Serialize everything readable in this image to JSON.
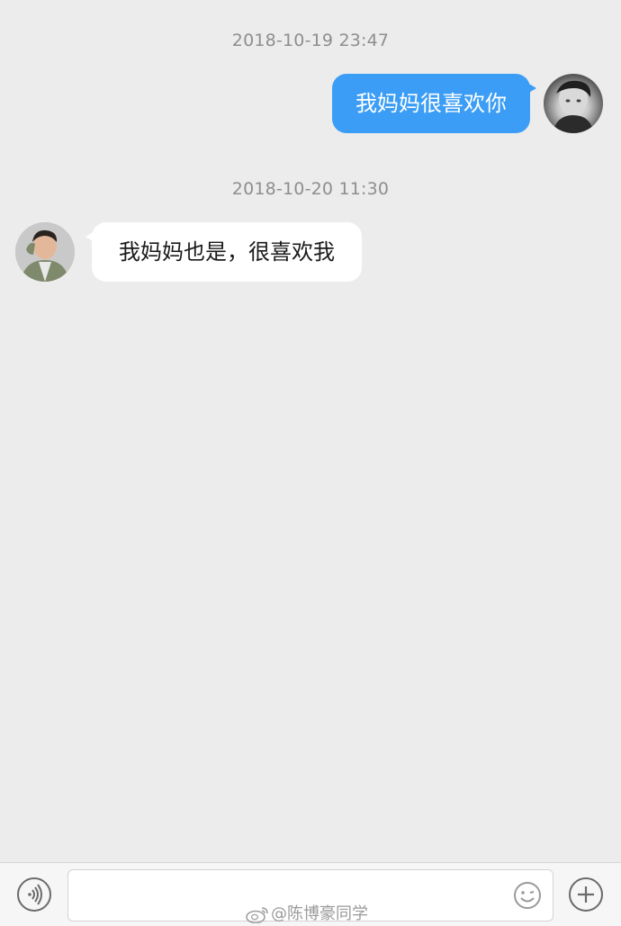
{
  "conversation": {
    "messages": [
      {
        "timestamp": "2018-10-19 23:47",
        "side": "right",
        "text": "我妈妈很喜欢你"
      },
      {
        "timestamp": "2018-10-20 11:30",
        "side": "left",
        "text": "我妈妈也是，很喜欢我"
      }
    ]
  },
  "colors": {
    "background": "#ececed",
    "outgoing_bubble": "#3b9df5",
    "incoming_bubble": "#ffffff",
    "timestamp_text": "#8e8e8e"
  },
  "input_bar": {
    "value": "",
    "placeholder": "",
    "left_icon": "voice-icon",
    "emoji_icon": "emoji-icon",
    "right_icon": "plus-icon"
  },
  "watermark": {
    "text": "@陈博豪同学",
    "icon": "weibo-logo-icon"
  }
}
